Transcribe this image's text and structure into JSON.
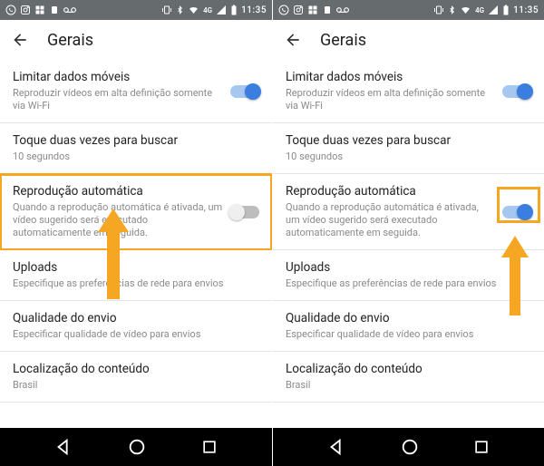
{
  "statusbar": {
    "network_label": "4G",
    "time": "11:35"
  },
  "toolbar": {
    "title": "Gerais"
  },
  "settings": {
    "limit_data": {
      "title": "Limitar dados móveis",
      "desc": "Reproduzir vídeos em alta definição somente via Wi-Fi"
    },
    "double_tap": {
      "title": "Toque duas vezes para buscar",
      "desc": "10 segundos"
    },
    "autoplay": {
      "title": "Reprodução automática",
      "desc": "Quando a reprodução automática é ativada, um vídeo sugerido será executado automaticamente em seguida."
    },
    "uploads": {
      "title": "Uploads",
      "desc": "Especifique as preferências de rede para envios"
    },
    "upload_quality": {
      "title": "Qualidade do envio",
      "desc": "Especificar qualidade de vídeo para envios"
    },
    "location": {
      "title": "Localização do conteúdo",
      "desc": "Brasil"
    }
  },
  "colors": {
    "accent": "#3a7ee0",
    "highlight": "#f5a623"
  }
}
